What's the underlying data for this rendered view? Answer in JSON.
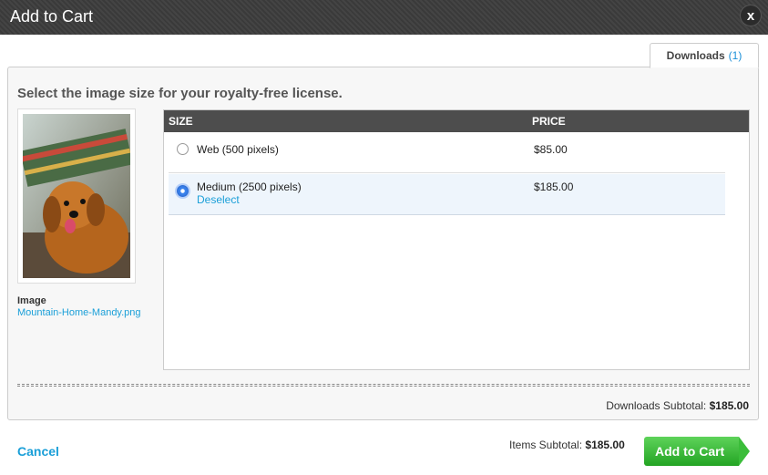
{
  "dialog": {
    "title": "Add to Cart",
    "close_label": "x"
  },
  "tabs": {
    "downloads_label": "Downloads",
    "downloads_count": "(1)"
  },
  "panel": {
    "instruction": "Select the image size for your royalty-free license.",
    "image_label": "Image",
    "image_filename": "Mountain-Home-Mandy.png"
  },
  "table": {
    "headers": {
      "size": "SIZE",
      "price": "PRICE"
    },
    "rows": [
      {
        "label": "Web (500 pixels)",
        "price": "$85.00",
        "selected": false
      },
      {
        "label": "Medium (2500 pixels)",
        "price": "$185.00",
        "selected": true,
        "action": "Deselect"
      }
    ]
  },
  "downloads_subtotal": {
    "label": "Downloads Subtotal:",
    "value": "$185.00"
  },
  "footer": {
    "cancel_label": "Cancel",
    "items_subtotal_label": "Items Subtotal:",
    "items_subtotal_value": "$185.00",
    "add_button_label": "Add to Cart"
  },
  "colors": {
    "accent_link": "#1a9fd8",
    "button_green": "#3bbd3a",
    "header_dark": "#4d4d4d"
  }
}
